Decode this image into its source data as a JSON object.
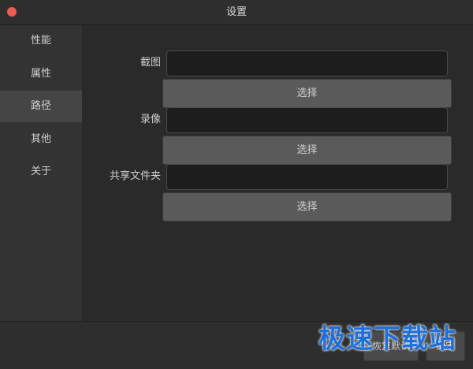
{
  "window": {
    "title": "设置"
  },
  "sidebar": {
    "items": [
      {
        "label": "性能"
      },
      {
        "label": "属性"
      },
      {
        "label": "路径"
      },
      {
        "label": "其他"
      },
      {
        "label": "关于"
      }
    ],
    "active_label": "路径"
  },
  "paths": {
    "screenshot": {
      "label": "截图",
      "value": "",
      "button": "选择"
    },
    "recording": {
      "label": "录像",
      "value": "",
      "button": "选择"
    },
    "shared_folder": {
      "label": "共享文件夹",
      "value": "",
      "button": "选择"
    }
  },
  "footer": {
    "restore_defaults": "恢复默认",
    "ok": "确定"
  },
  "watermark": "极速下载站",
  "colors": {
    "close_button": "#ee5b53",
    "watermark": "#1e6fd9"
  }
}
